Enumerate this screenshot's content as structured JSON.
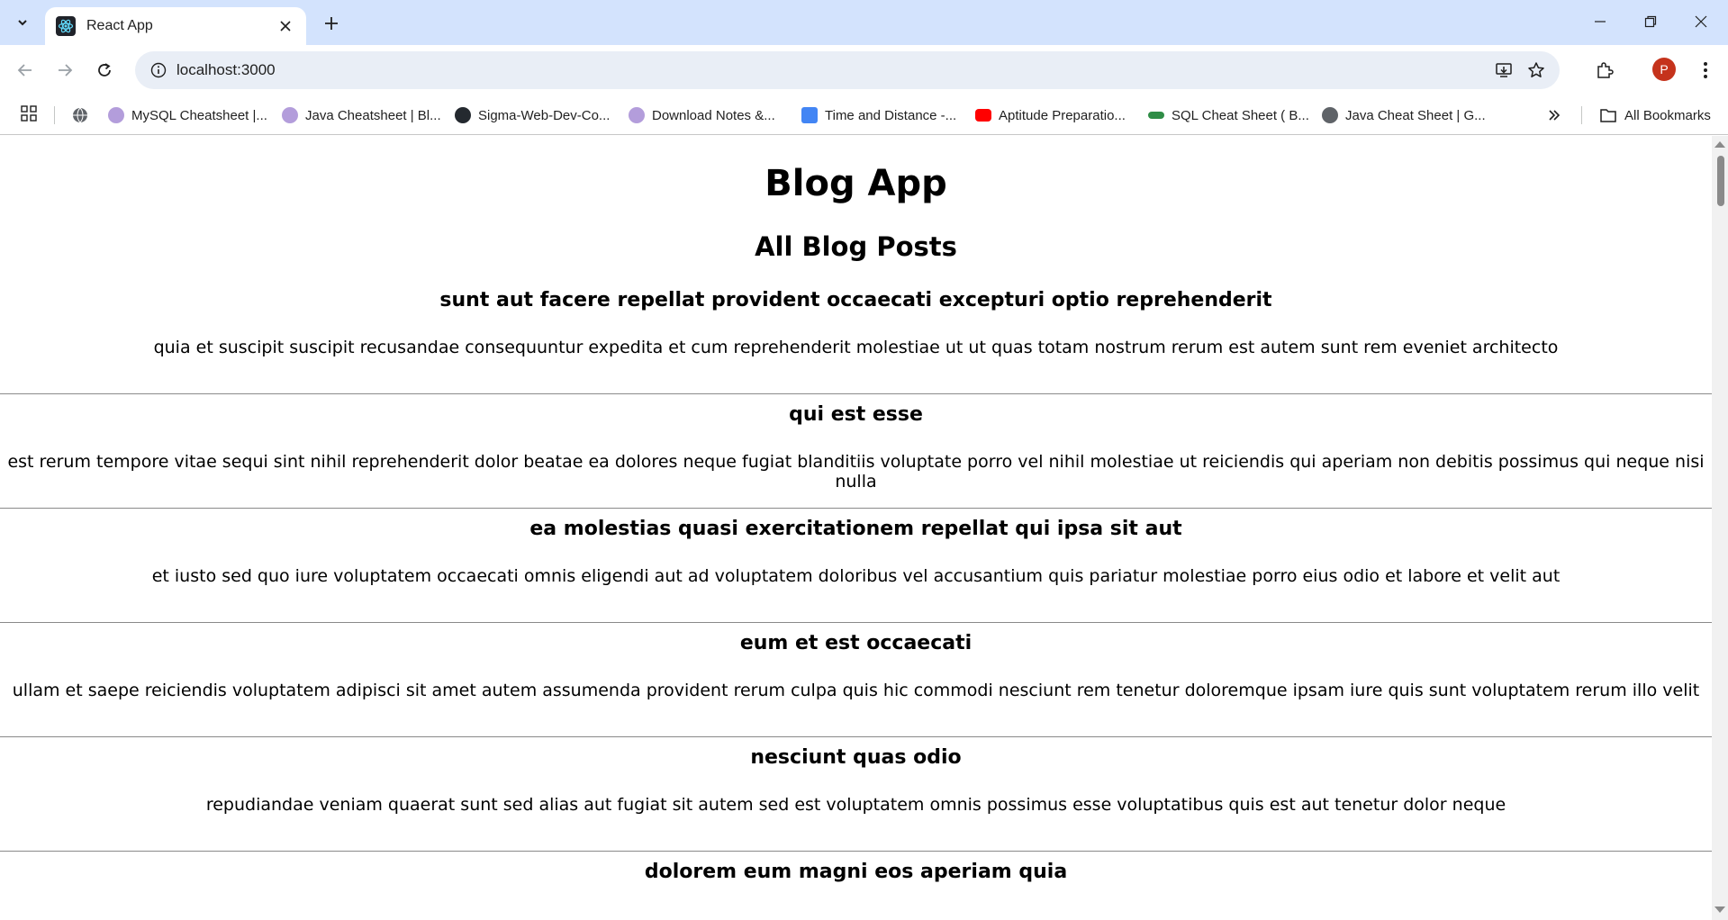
{
  "browser": {
    "tab_title": "React App",
    "url": "localhost:3000",
    "profile_initial": "P",
    "bookmarks": [
      {
        "label": "MySQL Cheatsheet |...",
        "icon": "avatar-icon"
      },
      {
        "label": "Java Cheatsheet | Bl...",
        "icon": "avatar-icon"
      },
      {
        "label": "Sigma-Web-Dev-Co...",
        "icon": "github-icon"
      },
      {
        "label": "Download Notes &...",
        "icon": "avatar-icon"
      },
      {
        "label": "Time and Distance -...",
        "icon": "docs-icon"
      },
      {
        "label": "Aptitude Preparatio...",
        "icon": "youtube-icon"
      },
      {
        "label": "SQL Cheat Sheet ( B...",
        "icon": "gfg-icon"
      },
      {
        "label": "Java Cheat Sheet | G...",
        "icon": "globe-icon"
      }
    ],
    "all_bookmarks_label": "All Bookmarks"
  },
  "page": {
    "app_title": "Blog App",
    "list_title": "All Blog Posts",
    "posts": [
      {
        "title": "sunt aut facere repellat provident occaecati excepturi optio reprehenderit",
        "body": "quia et suscipit suscipit recusandae consequuntur expedita et cum reprehenderit molestiae ut ut quas totam nostrum rerum est autem sunt rem eveniet architecto"
      },
      {
        "title": "qui est esse",
        "body": "est rerum tempore vitae sequi sint nihil reprehenderit dolor beatae ea dolores neque fugiat blanditiis voluptate porro vel nihil molestiae ut reiciendis qui aperiam non debitis possimus qui neque nisi nulla"
      },
      {
        "title": "ea molestias quasi exercitationem repellat qui ipsa sit aut",
        "body": "et iusto sed quo iure voluptatem occaecati omnis eligendi aut ad voluptatem doloribus vel accusantium quis pariatur molestiae porro eius odio et labore et velit aut"
      },
      {
        "title": "eum et est occaecati",
        "body": "ullam et saepe reiciendis voluptatem adipisci sit amet autem assumenda provident rerum culpa quis hic commodi nesciunt rem tenetur doloremque ipsam iure quis sunt voluptatem rerum illo velit"
      },
      {
        "title": "nesciunt quas odio",
        "body": "repudiandae veniam quaerat sunt sed alias aut fugiat sit autem sed est voluptatem omnis possimus esse voluptatibus quis est aut tenetur dolor neque"
      },
      {
        "title": "dolorem eum magni eos aperiam quia",
        "body": ""
      }
    ]
  }
}
